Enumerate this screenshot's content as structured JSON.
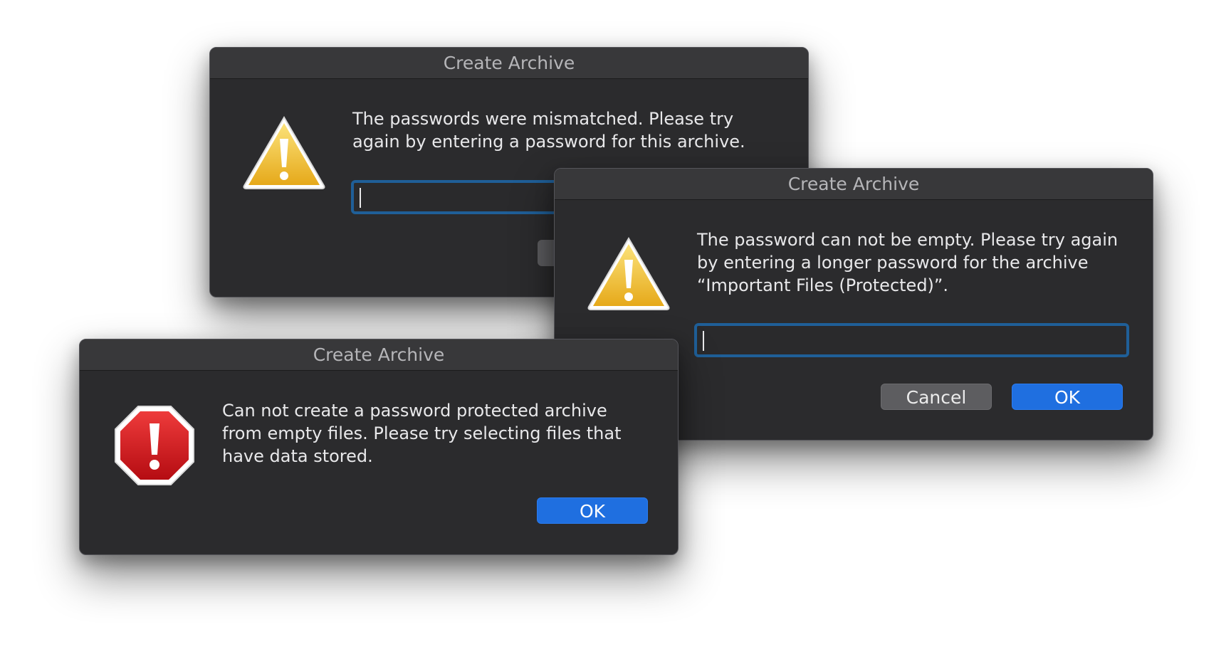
{
  "dialogs": {
    "mismatch": {
      "title": "Create Archive",
      "message_line1": "The passwords were mismatched. Please try",
      "message_line2": "again by entering a password for this archive.",
      "password_value": "",
      "icon": "warning-triangle-icon"
    },
    "empty_password": {
      "title": "Create Archive",
      "message_line1": "The password can not be empty. Please try again",
      "message_line2": "by entering a longer password for the archive",
      "message_line3": "“Important Files (Protected)”.",
      "password_value": "",
      "cancel_label": "Cancel",
      "ok_label": "OK",
      "icon": "warning-triangle-icon"
    },
    "empty_files": {
      "title": "Create Archive",
      "message_line1": "Can not create a password protected archive",
      "message_line2": "from empty files. Please try selecting files that",
      "message_line3": "have data stored.",
      "ok_label": "OK",
      "icon": "stop-octagon-icon"
    }
  },
  "colors": {
    "accent": "#1f6fe0",
    "focus_ring": "#1f5f98",
    "dialog_bg": "#2b2b2d",
    "warning": "#f2c230",
    "error": "#d0121b"
  }
}
